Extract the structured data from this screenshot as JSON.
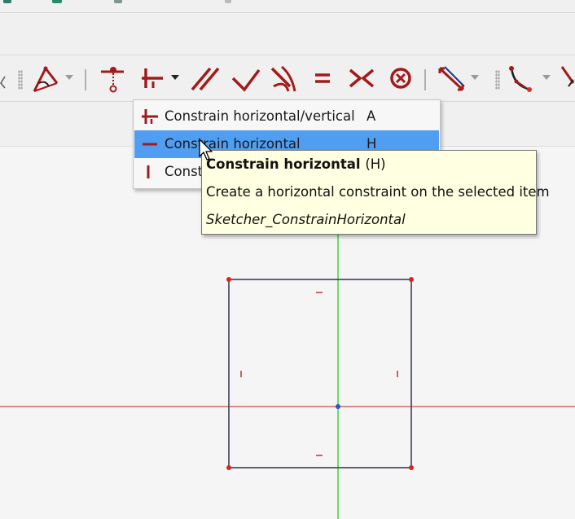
{
  "colors": {
    "accent_red": "#a21a1a",
    "selection_blue": "#509ef2",
    "tooltip_bg": "#ffffe1",
    "axis_red": "#d04848",
    "axis_green": "#38d838",
    "sketch_line": "#3c3e5a",
    "vertex": "#e02020"
  },
  "toolbar": {
    "tools": [
      {
        "name": "constrain-block-icon"
      },
      {
        "name": "constrain-coincident-icon"
      },
      {
        "name": "constrain-horizontal-vertical-icon"
      },
      {
        "name": "constrain-parallel-icon"
      },
      {
        "name": "constrain-perpendicular-icon"
      },
      {
        "name": "constrain-tangent-icon"
      },
      {
        "name": "constrain-equal-icon"
      },
      {
        "name": "constrain-symmetric-icon"
      },
      {
        "name": "constrain-lock-icon"
      },
      {
        "name": "constrain-distance-icon"
      },
      {
        "name": "constrain-radius-icon"
      }
    ]
  },
  "menu": {
    "items": [
      {
        "icon": "horizontal-vertical-icon",
        "label": "Constrain horizontal/vertical",
        "shortcut": "A"
      },
      {
        "icon": "horizontal-icon",
        "label": "Constrain horizontal",
        "shortcut": "H"
      },
      {
        "icon": "vertical-icon",
        "label": "Const",
        "shortcut": ""
      }
    ]
  },
  "tooltip": {
    "title": "Constrain horizontal",
    "key": "(H)",
    "description": "Create a horizontal constraint on the selected item",
    "command": "Sketcher_ConstrainHorizontal"
  }
}
